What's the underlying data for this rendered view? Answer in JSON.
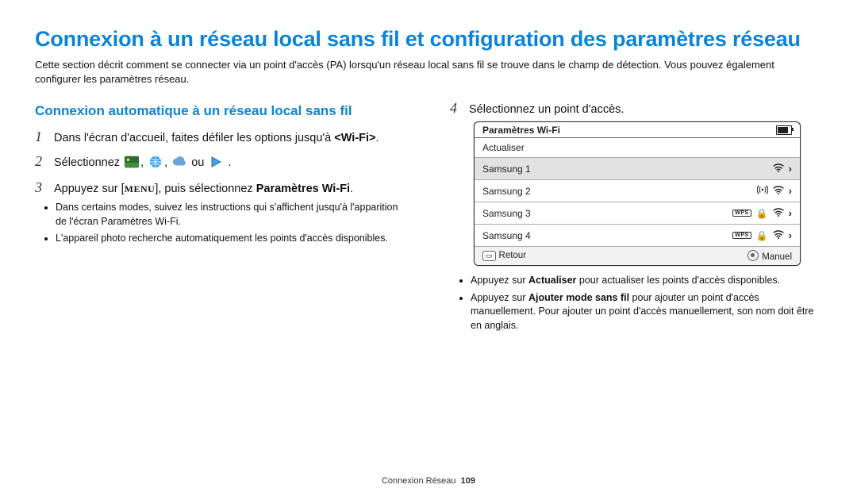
{
  "title": "Connexion à un réseau local sans fil et configuration des paramètres réseau",
  "intro": "Cette section décrit comment se connecter via un point d'accès (PA) lorsqu'un réseau local sans fil se trouve dans le champ de détection. Vous pouvez également configurer les paramètres réseau.",
  "section_heading": "Connexion automatique à un réseau local sans fil",
  "step1": {
    "num": "1",
    "pre": "Dans l'écran d'accueil, faites défiler les options jusqu'à ",
    "bold": "<Wi-Fi>",
    "post": "."
  },
  "step2": {
    "num": "2",
    "pre": "Sélectionnez ",
    "or": " ou ",
    "end": " ."
  },
  "step3": {
    "num": "3",
    "pre": "Appuyez sur [",
    "menu": "MENU",
    "mid": "], puis sélectionnez ",
    "bold": "Paramètres Wi-Fi",
    "post": ".",
    "bullets": [
      "Dans certains modes, suivez les instructions qui s'affichent jusqu'à l'apparition de l'écran Paramètres Wi-Fi.",
      "L'appareil photo recherche automatiquement les points d'accès disponibles."
    ]
  },
  "step4": {
    "num": "4",
    "text": "Sélectionnez un point d'accès."
  },
  "wifi_panel": {
    "title": "Paramètres Wi-Fi",
    "refresh": "Actualiser",
    "rows": [
      {
        "name": "Samsung 1"
      },
      {
        "name": "Samsung 2"
      },
      {
        "name": "Samsung 3"
      },
      {
        "name": "Samsung 4"
      }
    ],
    "back": "Retour",
    "manual": "Manuel"
  },
  "step4_bullets": {
    "b1_pre": "Appuyez sur ",
    "b1_bold": "Actualiser",
    "b1_post": " pour actualiser les points d'accès disponibles.",
    "b2_pre": "Appuyez sur ",
    "b2_bold": "Ajouter mode sans fil",
    "b2_post": " pour ajouter un point d'accès manuellement. Pour ajouter un point d'accès manuellement, son nom doit être en anglais."
  },
  "footer": {
    "section": "Connexion Réseau",
    "page": "109"
  }
}
